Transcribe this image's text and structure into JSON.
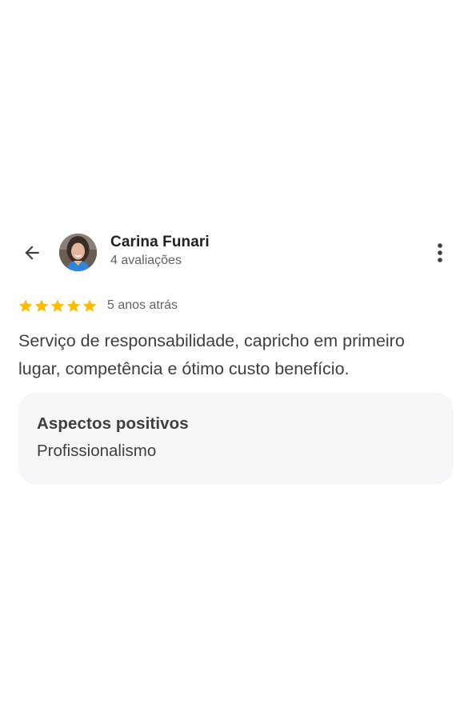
{
  "header": {
    "back_icon": "arrow-left-icon",
    "author_name": "Carina Funari",
    "author_reviews": "4 avaliações",
    "more_icon": "more-vert-icon"
  },
  "rating": {
    "stars": 5,
    "max_stars": 5,
    "star_color": "#fbbc04",
    "date": "5 anos atrás"
  },
  "review": {
    "text": "Serviço de responsabilidade, capricho em primeiro lugar, competência e ótimo custo benefício."
  },
  "aspects": {
    "title": "Aspectos positivos",
    "value": "Profissionalismo"
  },
  "colors": {
    "text_primary": "#202124",
    "text_secondary": "#5f6368",
    "body_text": "#3c4043",
    "box_background": "#f5f6f7",
    "icon": "#3c4043"
  }
}
